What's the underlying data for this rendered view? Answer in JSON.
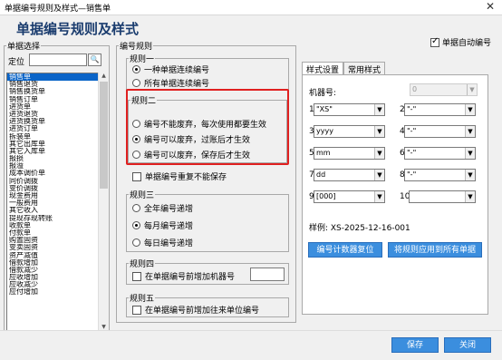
{
  "window": {
    "title": "单据编号规则及样式—销售单",
    "close_icon": "close-icon"
  },
  "heading": "单据编号规则及样式",
  "auto_number": {
    "label": "单据自动编号",
    "checked": true
  },
  "doc_select": {
    "legend": "单据选择",
    "locate_label": "定位",
    "locate_value": "",
    "items": [
      "销售单",
      "销售退货",
      "销售换货单",
      "销售订单",
      "进货单",
      "进货退货",
      "进货换货单",
      "进货订单",
      "拆装单",
      "其它出库单",
      "其它入库单",
      "报损",
      "报溢",
      "成本调价单",
      "同价调拨",
      "变价调拨",
      "现金费用",
      "一般费用",
      "其它收入",
      "提现存现转账",
      "收款单",
      "付款单",
      "购置固资",
      "变卖固资",
      "资产减值",
      "借款增加",
      "借款减少",
      "应收增加",
      "应收减少",
      "应付增加"
    ],
    "selected_index": 0
  },
  "rules": {
    "legend": "编号规则",
    "rule1": {
      "legend": "规则一",
      "options": [
        "一种单据连续编号",
        "所有单据连续编号"
      ],
      "selected": 0
    },
    "rule2": {
      "legend": "规则二",
      "options": [
        "编号不能废弃，每次使用都要生效",
        "编号可以废弃，过账后才生效",
        "编号可以废弃，保存后才生效"
      ],
      "selected": 1
    },
    "no_duplicate": {
      "label": "单据编号重复不能保存",
      "checked": false
    },
    "rule3": {
      "legend": "规则三",
      "options": [
        "全年编号递增",
        "每月编号递增",
        "每日编号递增"
      ],
      "selected": 1
    },
    "rule4": {
      "legend": "规则四",
      "label": "在单据编号前增加机器号",
      "checked": false,
      "value": ""
    },
    "rule5": {
      "legend": "规则五",
      "label": "在单据编号前增加往来单位编号",
      "checked": false
    }
  },
  "style": {
    "tabs": [
      "样式设置",
      "常用样式"
    ],
    "active_tab": 0,
    "machine_label": "机器号:",
    "machine_value": "0",
    "fields": [
      {
        "num": "1",
        "value": "\"XS\""
      },
      {
        "num": "2",
        "value": "\"-\""
      },
      {
        "num": "3",
        "value": "yyyy"
      },
      {
        "num": "4",
        "value": "\"-\""
      },
      {
        "num": "5",
        "value": "mm"
      },
      {
        "num": "6",
        "value": "\"-\""
      },
      {
        "num": "7",
        "value": "dd"
      },
      {
        "num": "8",
        "value": "\"-\""
      },
      {
        "num": "9",
        "value": "[000]"
      },
      {
        "num": "10",
        "value": ""
      }
    ],
    "sample": "样例: XS-2025-12-16-001",
    "reset_button": "编号计数器复位",
    "apply_all_button": "将规则应用到所有单据"
  },
  "footer": {
    "save_button": "保存",
    "close_button": "关闭"
  },
  "colors": {
    "accent": "#3b8ede",
    "selection": "#0a64c8",
    "highlight_box": "#e02020",
    "heading": "#1a3c6e"
  }
}
